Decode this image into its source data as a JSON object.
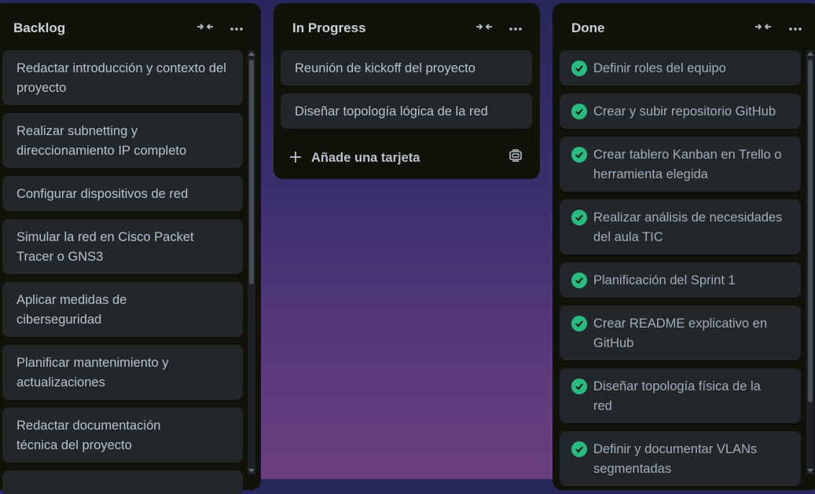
{
  "lists": {
    "backlog": {
      "title": "Backlog",
      "cards": [
        "Redactar introducción y contexto del proyecto",
        "Realizar subnetting y direccionamiento IP completo",
        "Configurar dispositivos de red",
        "Simular la red en Cisco Packet Tracer o GNS3",
        "Aplicar medidas de ciberseguridad",
        "Planificar mantenimiento y actualizaciones",
        "Redactar documentación técnica del proyecto"
      ]
    },
    "progress": {
      "title": "In Progress",
      "cards": [
        "Reunión de kickoff del proyecto",
        "Diseñar topología lógica de la red"
      ],
      "add_card_label": "Añade una tarjeta"
    },
    "done": {
      "title": "Done",
      "cards": [
        "Definir roles del equipo",
        "Crear y subir repositorio GitHub",
        "Crear tablero Kanban en Trello o herramienta elegida",
        "Realizar análisis de necesidades del aula TIC",
        "Planificación del Sprint 1",
        "Crear README explicativo en GitHub",
        "Diseñar topología física de la red",
        "Definir y documentar VLANs segmentadas"
      ]
    }
  },
  "icons": {
    "collapse": "collapse-arrows-icon",
    "more": "more-options-icon",
    "check": "check-circle-icon",
    "add": "plus-icon",
    "template": "card-template-icon"
  },
  "colors": {
    "list_bg": "#111309",
    "card_bg": "#22272b",
    "check_green": "#2abb7f",
    "text": "#b6c2cf"
  }
}
